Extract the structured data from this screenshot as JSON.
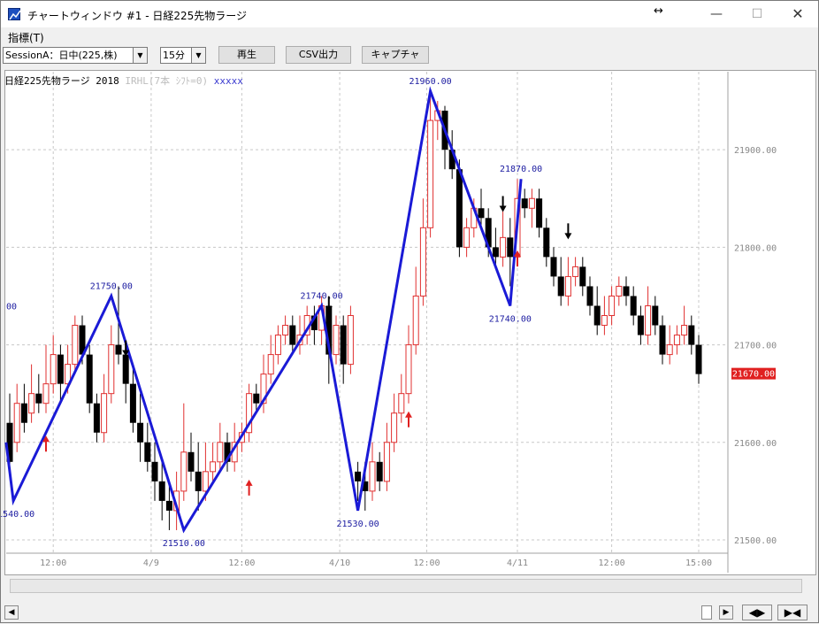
{
  "window": {
    "title": "チャートウィンドウ #1 - 日経225先物ラージ",
    "menu_indicator": "指標(T)"
  },
  "toolbar": {
    "session_value": "SessionA：日中(225,株)",
    "interval_value": "15分",
    "play_label": "再生",
    "csv_label": "CSV出力",
    "capture_label": "キャプチャ"
  },
  "chart_header": {
    "title": "日経225先物ラージ 2018",
    "indicator": "IRHL(7本 ｼﾌﾄ=0)",
    "tag": "xxxxx"
  },
  "colors": {
    "zigzag": "#1a1ad6",
    "up_candle": "#e03030",
    "down_candle": "#000000",
    "last_price_bg": "#e02020",
    "grid": "#c8c8c8",
    "label": "#1a1aa0"
  },
  "chart_data": {
    "type": "candlestick",
    "x_tick_labels": [
      "12:00",
      "4/9",
      "12:00",
      "4/10",
      "12:00",
      "4/11",
      "12:00",
      "15:00"
    ],
    "y_tick_labels": [
      "21500.00",
      "21600.00",
      "21700.00",
      "21800.00",
      "21900.00"
    ],
    "ylim": [
      21490,
      21980
    ],
    "last_price_label": "21670.00",
    "truncated_left_label": "00",
    "zigzag": [
      {
        "i": -0.5,
        "v": 21600,
        "label": ""
      },
      {
        "i": 0.5,
        "v": 21540,
        "label": "21540.00"
      },
      {
        "i": 14,
        "v": 21750,
        "label": "21750.00"
      },
      {
        "i": 24,
        "v": 21510,
        "label": "21510.00"
      },
      {
        "i": 43,
        "v": 21740,
        "label": "21740.00"
      },
      {
        "i": 48,
        "v": 21530,
        "label": "21530.00"
      },
      {
        "i": 58,
        "v": 21960,
        "label": "21960.00"
      },
      {
        "i": 69,
        "v": 21740,
        "label": "21740.00"
      },
      {
        "i": 70.5,
        "v": 21870,
        "label": "21870.00"
      }
    ],
    "up_arrows": [
      {
        "i": 5,
        "v": 21605
      },
      {
        "i": 33,
        "v": 21560
      },
      {
        "i": 55,
        "v": 21630
      },
      {
        "i": 70,
        "v": 21795
      }
    ],
    "down_arrows": [
      {
        "i": 16,
        "v": 21690
      },
      {
        "i": 44,
        "v": 21735
      },
      {
        "i": 68,
        "v": 21838
      },
      {
        "i": 77,
        "v": 21810
      }
    ],
    "candles": [
      [
        21620,
        21580,
        21650,
        21570
      ],
      [
        21600,
        21640,
        21660,
        21590
      ],
      [
        21640,
        21620,
        21660,
        21610
      ],
      [
        21630,
        21650,
        21680,
        21620
      ],
      [
        21650,
        21640,
        21670,
        21630
      ],
      [
        21640,
        21660,
        21700,
        21630
      ],
      [
        21660,
        21690,
        21710,
        21650
      ],
      [
        21690,
        21660,
        21700,
        21640
      ],
      [
        21660,
        21680,
        21700,
        21650
      ],
      [
        21680,
        21720,
        21730,
        21670
      ],
      [
        21720,
        21690,
        21730,
        21680
      ],
      [
        21690,
        21640,
        21700,
        21630
      ],
      [
        21640,
        21610,
        21650,
        21600
      ],
      [
        21610,
        21650,
        21670,
        21600
      ],
      [
        21650,
        21700,
        21720,
        21640
      ],
      [
        21700,
        21690,
        21760,
        21680
      ],
      [
        21690,
        21660,
        21700,
        21640
      ],
      [
        21660,
        21620,
        21680,
        21610
      ],
      [
        21620,
        21600,
        21650,
        21580
      ],
      [
        21600,
        21580,
        21620,
        21570
      ],
      [
        21580,
        21560,
        21600,
        21540
      ],
      [
        21560,
        21540,
        21580,
        21520
      ],
      [
        21540,
        21530,
        21560,
        21510
      ],
      [
        21530,
        21550,
        21570,
        21510
      ],
      [
        21550,
        21590,
        21640,
        21540
      ],
      [
        21590,
        21570,
        21610,
        21560
      ],
      [
        21570,
        21550,
        21600,
        21530
      ],
      [
        21550,
        21570,
        21600,
        21540
      ],
      [
        21570,
        21580,
        21600,
        21560
      ],
      [
        21580,
        21600,
        21620,
        21570
      ],
      [
        21600,
        21580,
        21610,
        21570
      ],
      [
        21580,
        21600,
        21620,
        21570
      ],
      [
        21600,
        21610,
        21620,
        21590
      ],
      [
        21610,
        21650,
        21660,
        21600
      ],
      [
        21650,
        21640,
        21660,
        21630
      ],
      [
        21640,
        21670,
        21690,
        21630
      ],
      [
        21670,
        21690,
        21710,
        21660
      ],
      [
        21690,
        21710,
        21720,
        21680
      ],
      [
        21710,
        21720,
        21730,
        21700
      ],
      [
        21720,
        21700,
        21730,
        21690
      ],
      [
        21700,
        21710,
        21730,
        21690
      ],
      [
        21710,
        21730,
        21740,
        21700
      ],
      [
        21730,
        21715,
        21740,
        21700
      ],
      [
        21715,
        21740,
        21750,
        21700
      ],
      [
        21740,
        21690,
        21750,
        21660
      ],
      [
        21690,
        21720,
        21730,
        21680
      ],
      [
        21720,
        21680,
        21730,
        21660
      ],
      [
        21680,
        21730,
        21740,
        21670
      ],
      [
        21570,
        21560,
        21580,
        21540
      ],
      [
        21560,
        21550,
        21580,
        21530
      ],
      [
        21550,
        21580,
        21600,
        21540
      ],
      [
        21580,
        21560,
        21590,
        21550
      ],
      [
        21560,
        21600,
        21620,
        21550
      ],
      [
        21600,
        21630,
        21650,
        21590
      ],
      [
        21630,
        21650,
        21670,
        21620
      ],
      [
        21650,
        21700,
        21720,
        21640
      ],
      [
        21700,
        21750,
        21780,
        21690
      ],
      [
        21750,
        21820,
        21850,
        21740
      ],
      [
        21820,
        21930,
        21960,
        21810
      ],
      [
        21930,
        21940,
        21950,
        21910
      ],
      [
        21940,
        21900,
        21945,
        21880
      ],
      [
        21900,
        21880,
        21920,
        21870
      ],
      [
        21880,
        21800,
        21890,
        21790
      ],
      [
        21800,
        21820,
        21830,
        21790
      ],
      [
        21820,
        21840,
        21850,
        21810
      ],
      [
        21840,
        21830,
        21860,
        21820
      ],
      [
        21830,
        21800,
        21840,
        21790
      ],
      [
        21800,
        21790,
        21820,
        21780
      ],
      [
        21790,
        21810,
        21840,
        21780
      ],
      [
        21810,
        21790,
        21830,
        21760
      ],
      [
        21790,
        21850,
        21870,
        21780
      ],
      [
        21850,
        21840,
        21860,
        21830
      ],
      [
        21840,
        21850,
        21860,
        21820
      ],
      [
        21850,
        21820,
        21860,
        21810
      ],
      [
        21820,
        21790,
        21830,
        21780
      ],
      [
        21790,
        21770,
        21800,
        21760
      ],
      [
        21770,
        21750,
        21790,
        21740
      ],
      [
        21750,
        21770,
        21790,
        21740
      ],
      [
        21770,
        21780,
        21790,
        21760
      ],
      [
        21780,
        21760,
        21790,
        21750
      ],
      [
        21760,
        21740,
        21770,
        21730
      ],
      [
        21740,
        21720,
        21760,
        21710
      ],
      [
        21720,
        21730,
        21750,
        21710
      ],
      [
        21730,
        21750,
        21760,
        21720
      ],
      [
        21750,
        21760,
        21770,
        21740
      ],
      [
        21760,
        21750,
        21770,
        21740
      ],
      [
        21750,
        21730,
        21760,
        21720
      ],
      [
        21730,
        21710,
        21740,
        21700
      ],
      [
        21710,
        21740,
        21760,
        21700
      ],
      [
        21740,
        21720,
        21750,
        21710
      ],
      [
        21720,
        21690,
        21730,
        21680
      ],
      [
        21690,
        21700,
        21720,
        21680
      ],
      [
        21700,
        21710,
        21720,
        21690
      ],
      [
        21710,
        21720,
        21740,
        21700
      ],
      [
        21720,
        21700,
        21730,
        21690
      ],
      [
        21700,
        21670,
        21710,
        21660
      ]
    ]
  }
}
